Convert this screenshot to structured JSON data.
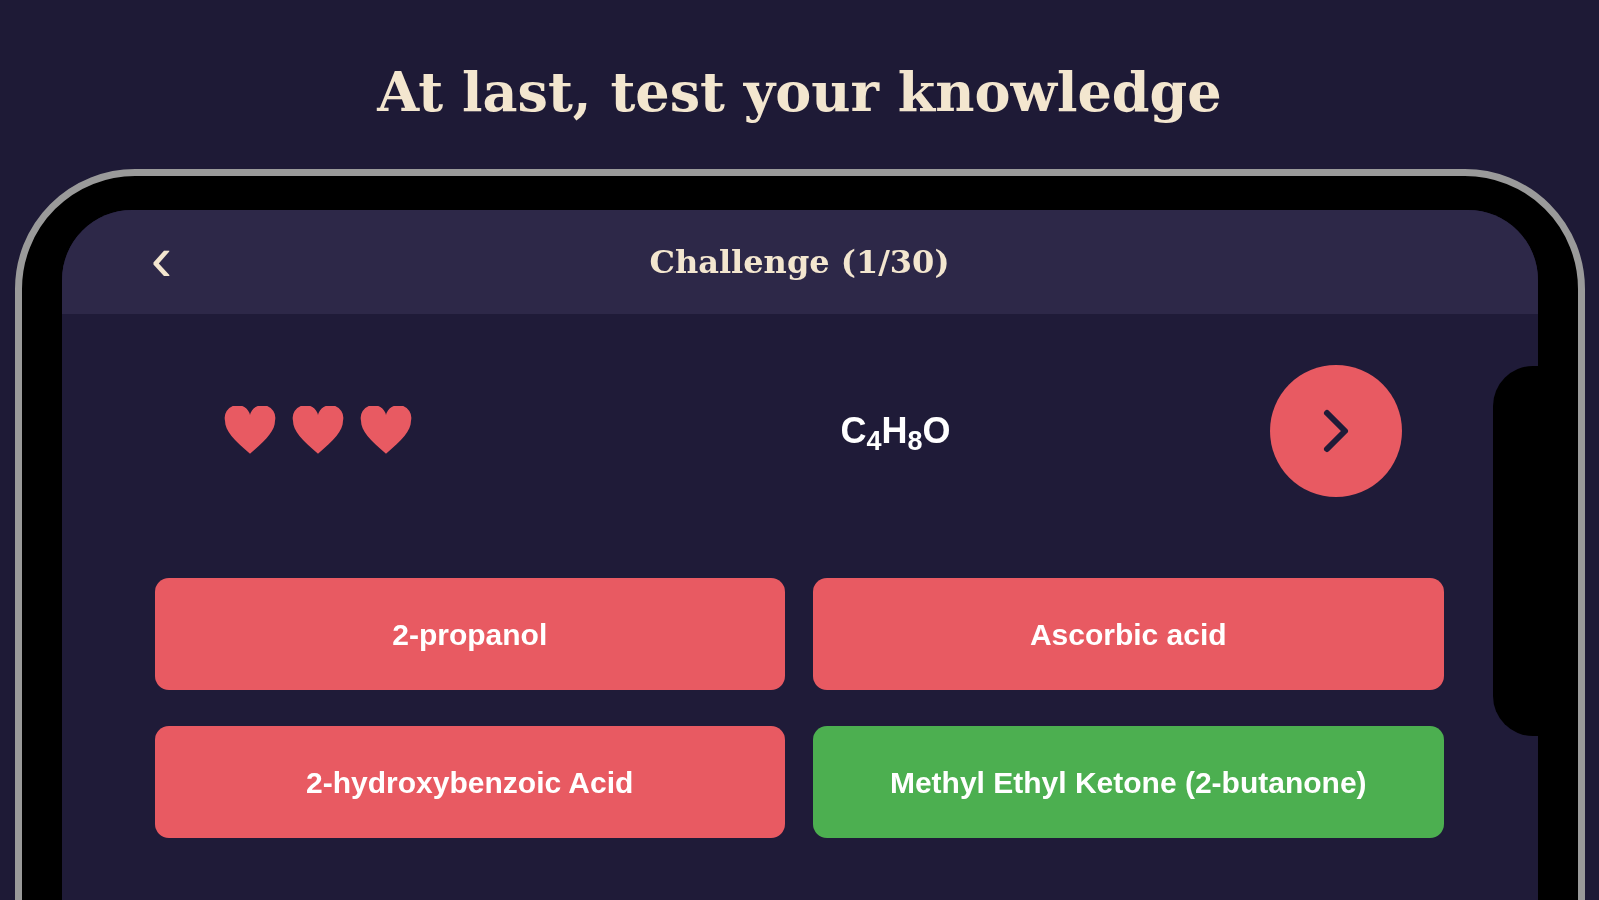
{
  "headline": "At last, test your knowledge",
  "header": {
    "back": "‹",
    "title": "Challenge (1/30)"
  },
  "hearts": {
    "stars": 3
  },
  "question": {
    "formula": "C$_{4}$H$_{8}$O"
  },
  "answers": [
    {
      "label": "2-propanol",
      "kind": "wrong"
    },
    {
      "label": "Ascorbic acid",
      "kind": "wrong"
    },
    {
      "label": "2-hydroxybenzoic Acid",
      "kind": "wrong"
    },
    {
      "label": "Methyl Ethyl Ketone (2-butanone)",
      "kind": "correct"
    }
  ]
}
